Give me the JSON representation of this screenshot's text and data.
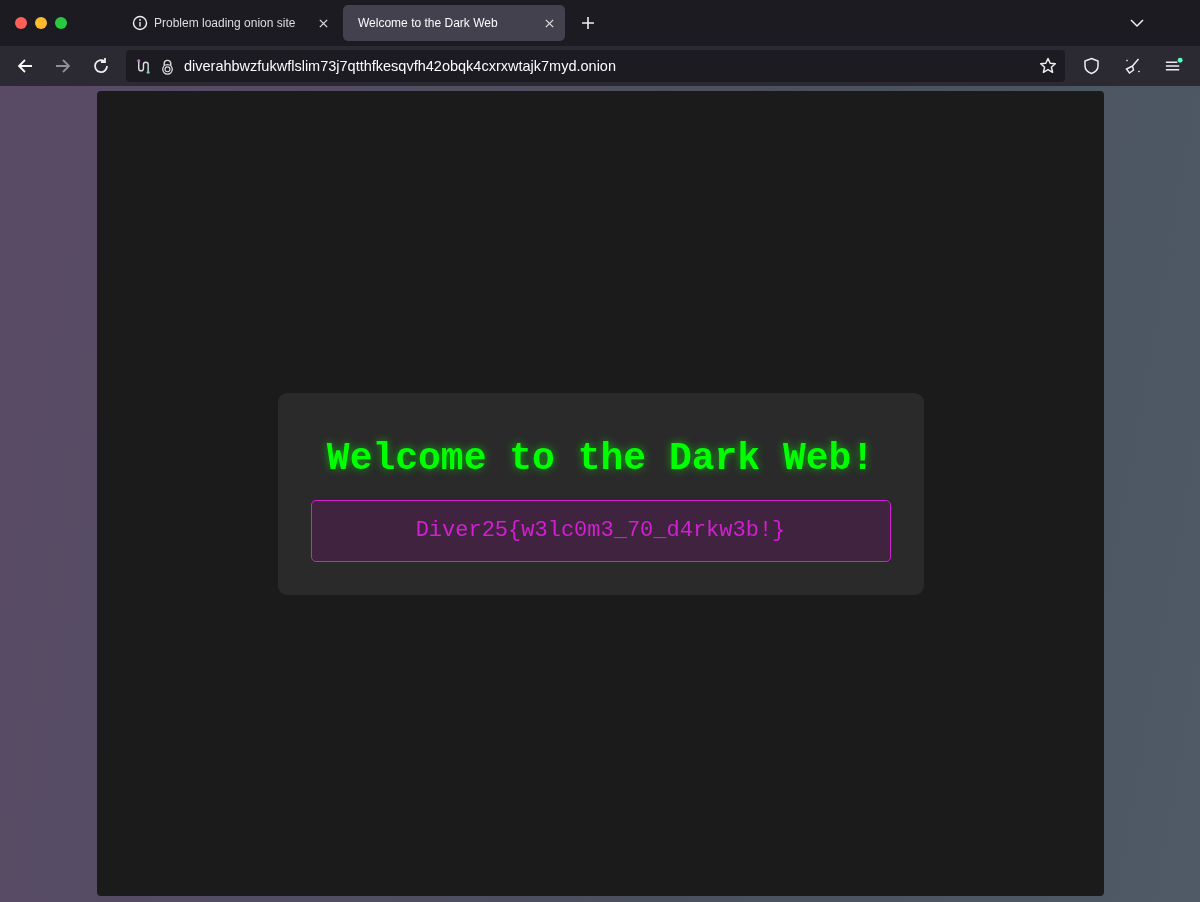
{
  "tabs": [
    {
      "kind": "error",
      "label": "Problem loading onion site",
      "selected": false
    },
    {
      "kind": "page",
      "label": "Welcome to the Dark Web",
      "selected": true
    }
  ],
  "nav": {
    "back_disabled": false,
    "forward_disabled": true
  },
  "address": {
    "value": "diverahbwzfukwflslim73j7qtthfkesqvfh42obqk4cxrxwtajk7myd.onion"
  },
  "page": {
    "heading": "Welcome to the Dark Web!",
    "flag": "Diver25{w3lc0m3_70_d4rkw3b!}"
  }
}
